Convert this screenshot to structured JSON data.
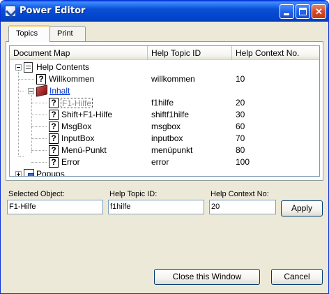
{
  "window": {
    "title": "Power Editor"
  },
  "tabs": [
    {
      "label": "Topics",
      "active": true
    },
    {
      "label": "Print",
      "active": false
    }
  ],
  "listview": {
    "columns": [
      "Document Map",
      "Help Topic ID",
      "Help Context No."
    ],
    "rows": [
      {
        "label": "Help Contents",
        "icon": "document-icon",
        "expander": "minus",
        "id": "",
        "ctx": ""
      },
      {
        "label": "Willkommen",
        "icon": "help-topic-icon",
        "expander": "",
        "id": "willkommen",
        "ctx": "10"
      },
      {
        "label": "Inhalt",
        "icon": "book-icon",
        "expander": "minus",
        "id": "",
        "ctx": ""
      },
      {
        "label": "F1-Hilfe",
        "icon": "help-topic-icon",
        "expander": "",
        "id": "f1hilfe",
        "ctx": "20",
        "selected": true
      },
      {
        "label": "Shift+F1-Hilfe",
        "icon": "help-topic-icon",
        "expander": "",
        "id": "shiftf1hilfe",
        "ctx": "30"
      },
      {
        "label": "MsgBox",
        "icon": "help-topic-icon",
        "expander": "",
        "id": "msgbox",
        "ctx": "60"
      },
      {
        "label": "InputBox",
        "icon": "help-topic-icon",
        "expander": "",
        "id": "inputbox",
        "ctx": "70"
      },
      {
        "label": "Menü-Punkt",
        "icon": "help-topic-icon",
        "expander": "",
        "id": "menüpunkt",
        "ctx": "80"
      },
      {
        "label": "Error",
        "icon": "help-topic-icon",
        "expander": "",
        "id": "error",
        "ctx": "100"
      },
      {
        "label": "Popups",
        "icon": "popups-icon",
        "expander": "plus",
        "id": "",
        "ctx": ""
      }
    ]
  },
  "fields": {
    "selected_object": {
      "label": "Selected Object:",
      "value": "F1-Hilfe"
    },
    "help_topic_id": {
      "label": "Help Topic ID:",
      "value": "f1hilfe"
    },
    "help_context_no": {
      "label": "Help Context No:",
      "value": "20"
    }
  },
  "buttons": {
    "apply": "Apply",
    "close_window": "Close this Window",
    "cancel": "Cancel"
  },
  "colors": {
    "titlebar": "#0A4FD6",
    "window_bg": "#ECE9D8",
    "link": "#0033CC"
  }
}
